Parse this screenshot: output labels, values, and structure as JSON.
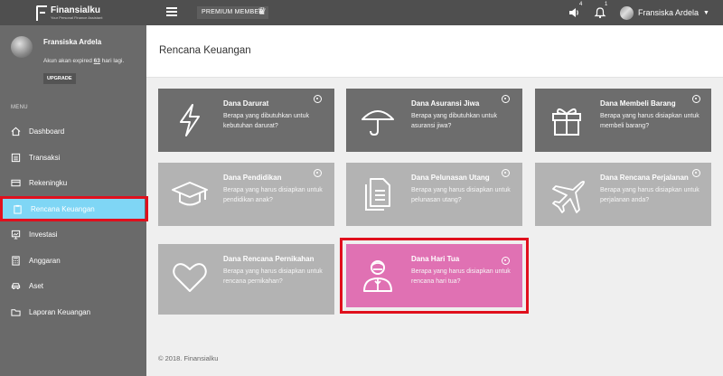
{
  "topbar": {
    "logo_name": "Finansialku",
    "logo_tag": "Your Personal Finance Assistant",
    "premium_label": "PREMIUM MEMBER",
    "notif_count_1": "4",
    "notif_count_2": "1",
    "user_name": "Fransiska Ardela"
  },
  "sidebar": {
    "profile_name": "Fransiska Ardela",
    "expiry_prefix": "Akun akan expired ",
    "expiry_days": "63",
    "expiry_suffix": " hari lagi.",
    "upgrade_label": "UPGRADE",
    "menu_label": "MENU",
    "items": [
      {
        "label": "Dashboard",
        "icon": "home-icon"
      },
      {
        "label": "Transaksi",
        "icon": "list-icon"
      },
      {
        "label": "Rekeningku",
        "icon": "card-icon"
      },
      {
        "label": "Rencana Keuangan",
        "icon": "clipboard-icon",
        "active": true
      },
      {
        "label": "Investasi",
        "icon": "chart-icon"
      },
      {
        "label": "Anggaran",
        "icon": "calculator-icon"
      },
      {
        "label": "Aset",
        "icon": "car-icon"
      },
      {
        "label": "Laporan Keuangan",
        "icon": "folder-icon"
      }
    ]
  },
  "main": {
    "title": "Rencana Keuangan",
    "cards": [
      {
        "title": "Dana Darurat",
        "desc": "Berapa yang dibutuhkan untuk kebutuhan darurat?",
        "style": "dark",
        "icon": "lightning-icon"
      },
      {
        "title": "Dana Asuransi Jiwa",
        "desc": "Berapa yang dibutuhkan untuk asuransi jiwa?",
        "style": "dark",
        "icon": "umbrella-icon"
      },
      {
        "title": "Dana Membeli Barang",
        "desc": "Berapa yang harus disiapkan untuk membeli barang?",
        "style": "dark",
        "icon": "gift-icon"
      },
      {
        "title": "Dana Pendidikan",
        "desc": "Berapa yang harus disiapkan untuk pendidikan anak?",
        "style": "light",
        "icon": "graduation-cap-icon"
      },
      {
        "title": "Dana Pelunasan Utang",
        "desc": "Berapa yang harus disiapkan untuk pelunasan utang?",
        "style": "light",
        "icon": "document-icon"
      },
      {
        "title": "Dana Rencana Perjalanan",
        "desc": "Berapa yang harus disiapkan untuk perjalanan anda?",
        "style": "light",
        "icon": "airplane-icon"
      },
      {
        "title": "Dana Rencana Pernikahan",
        "desc": "Berapa yang harus disiapkan untuk rencana pernikahan?",
        "style": "light",
        "icon": "heart-icon"
      },
      {
        "title": "Dana Hari Tua",
        "desc": "Berapa yang harus disiapkan untuk rencana hari tua?",
        "style": "pink",
        "icon": "elder-person-icon"
      }
    ]
  },
  "footer": {
    "text": "© 2018. Finansialku"
  },
  "colors": {
    "topbar": "#4f4f4f",
    "sidebar": "#6a6a6a",
    "active": "#7fd6f5",
    "card_dark": "#6d6d6d",
    "card_light": "#b3b3b3",
    "card_pink": "#e071b3",
    "highlight": "#e0101d"
  }
}
